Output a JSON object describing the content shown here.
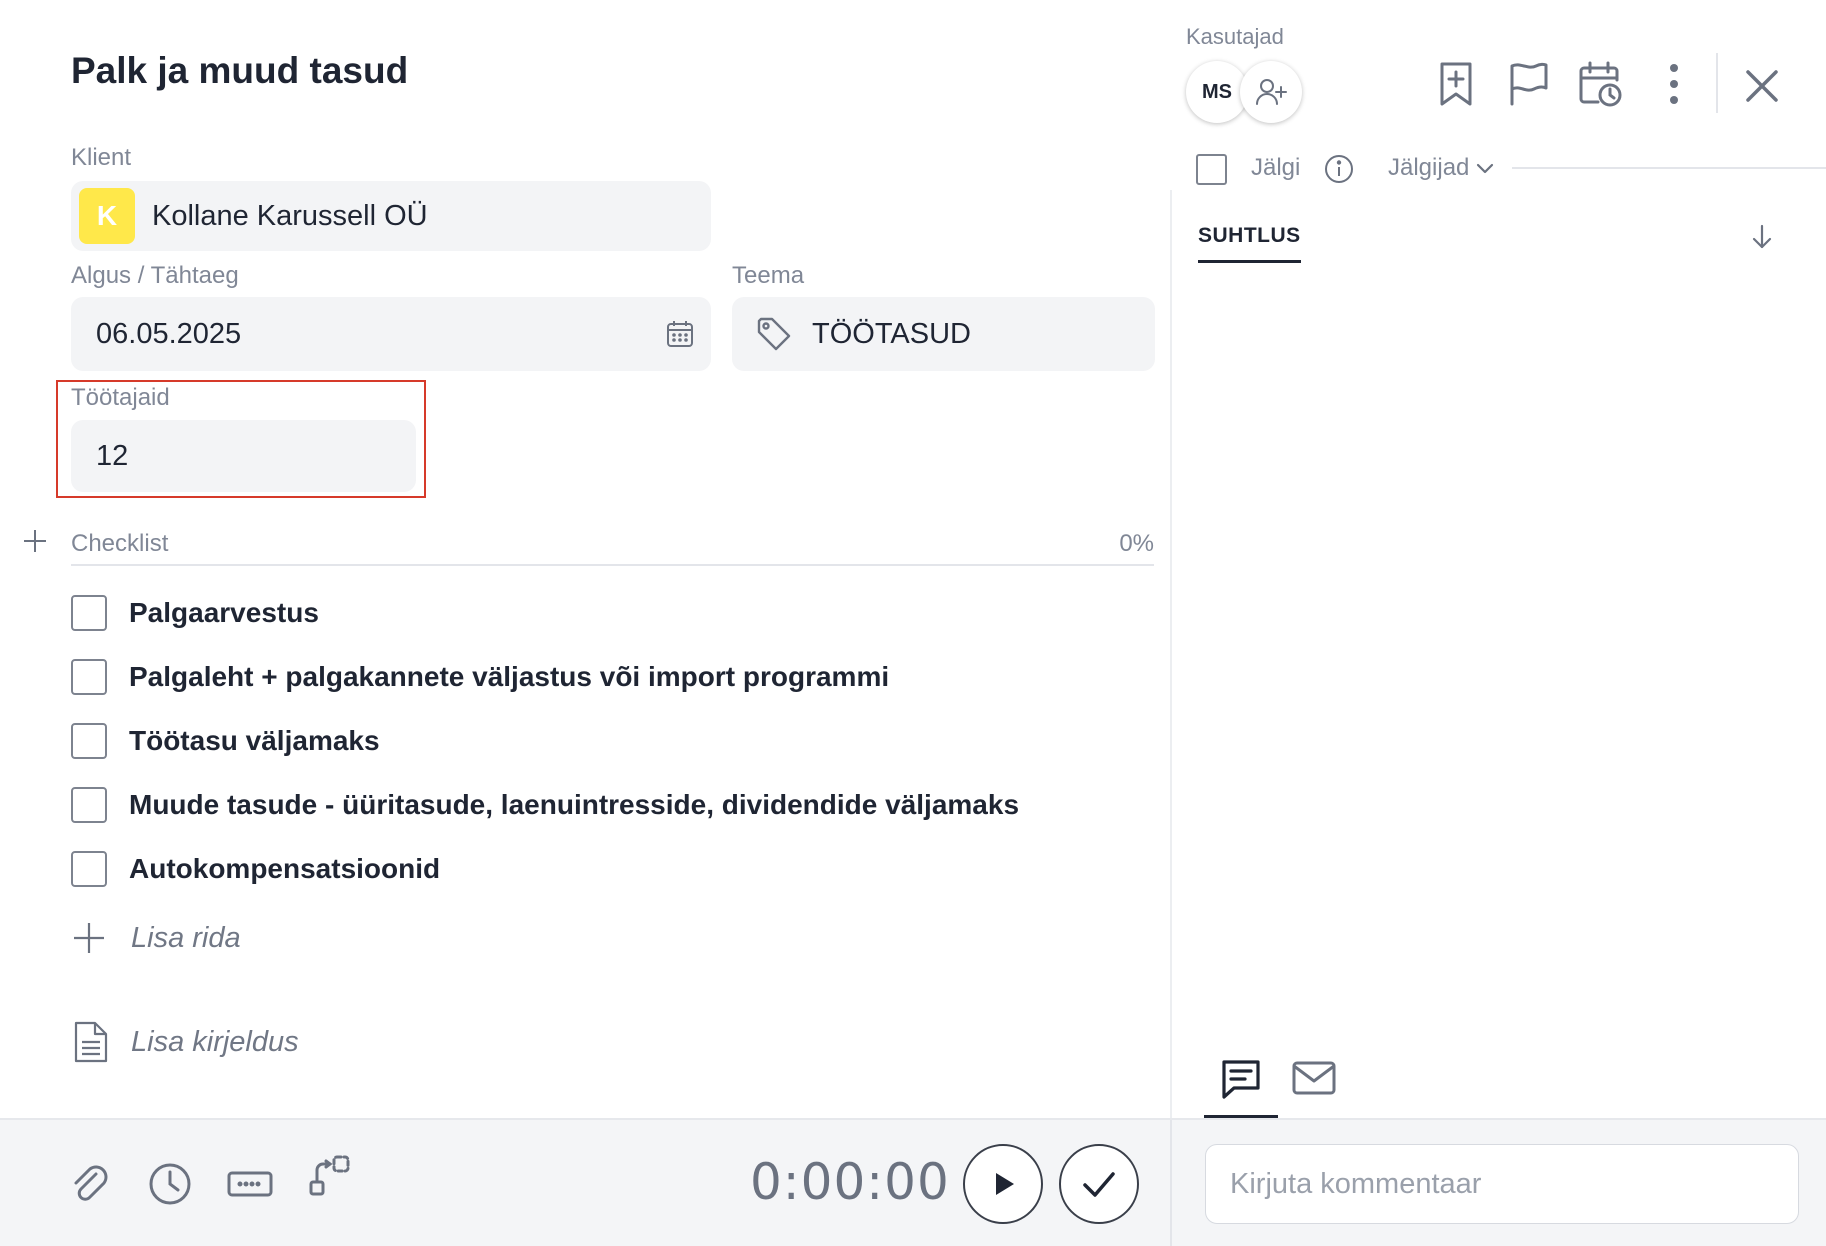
{
  "task": {
    "title": "Palk ja muud tasud"
  },
  "client": {
    "label": "Klient",
    "avatar_letter": "K",
    "name": "Kollane Karussell OÜ"
  },
  "dates": {
    "label": "Algus / Tähtaeg",
    "value": "06.05.2025"
  },
  "theme": {
    "label": "Teema",
    "value": "TÖÖTASUD"
  },
  "employees": {
    "label": "Töötajaid",
    "value": "12"
  },
  "checklist": {
    "label": "Checklist",
    "percent": "0%",
    "items": [
      {
        "text": "Palgaarvestus",
        "checked": false
      },
      {
        "text": "Palgaleht + palgakannete väljastus või import programmi",
        "checked": false
      },
      {
        "text": "Töötasu väljamaks",
        "checked": false
      },
      {
        "text": "Muude tasude - üüritasude, laenuintresside, dividendide väljamaks",
        "checked": false
      },
      {
        "text": "Autokompensatsioonid",
        "checked": false
      }
    ],
    "add_row": "Lisa rida"
  },
  "description": {
    "add_label": "Lisa kirjeldus"
  },
  "footer": {
    "timer": "0:00:00",
    "icons": [
      "paperclip-icon",
      "clock-icon",
      "keyboard-icon",
      "dependency-icon"
    ]
  },
  "users": {
    "label": "Kasutajad",
    "initials": "MS"
  },
  "follow": {
    "label": "Jälgi",
    "followers_label": "Jälgijad"
  },
  "tabs": {
    "communication": "SUHTLUS"
  },
  "comment": {
    "placeholder": "Kirjuta kommentaar"
  },
  "colors": {
    "client_avatar": "#ffe84a",
    "highlight": "#d63a2a",
    "text": "#1f2533",
    "muted": "#808796"
  }
}
